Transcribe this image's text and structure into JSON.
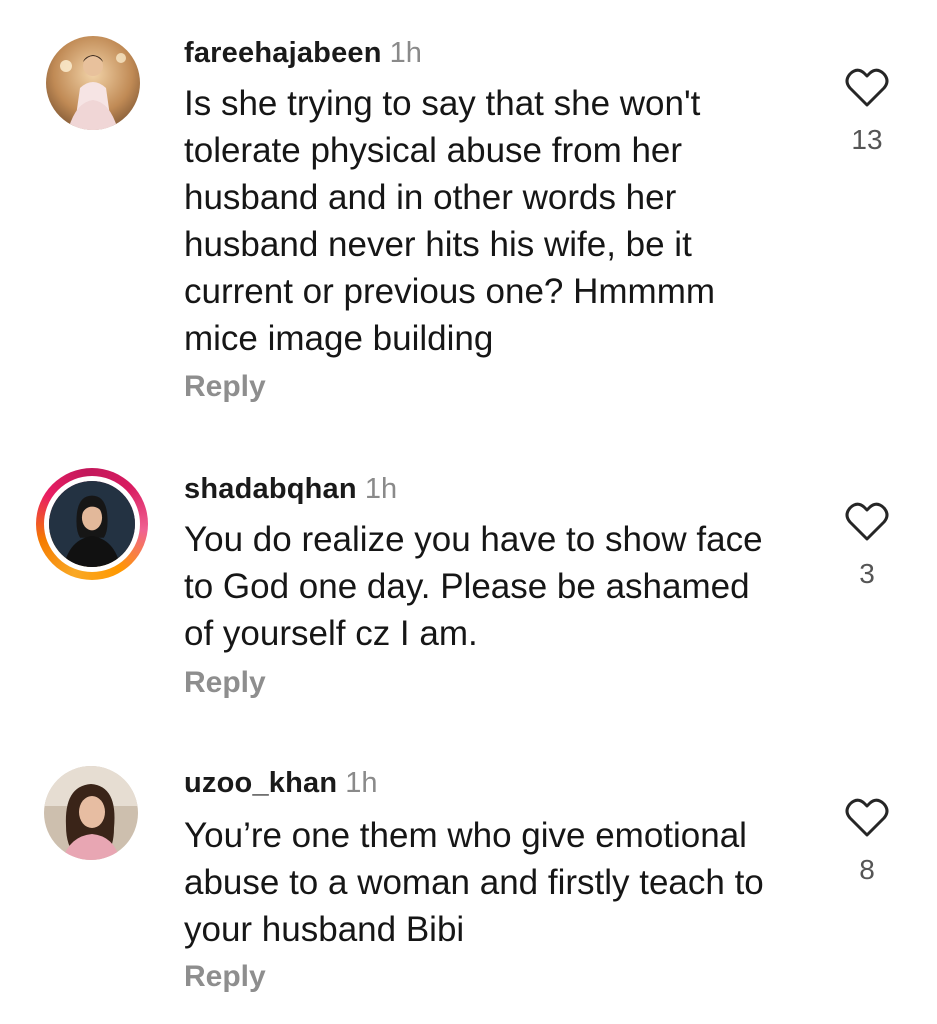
{
  "comments": [
    {
      "username": "fareehajabeen",
      "time": "1h",
      "text": "Is she trying to say that she won't tolerate physical abuse from her husband and in other words her husband never hits his wife, be it current or previous one? Hmmmm mice image building",
      "reply_label": "Reply",
      "likes": "13",
      "has_story": false
    },
    {
      "username": "shadabqhan",
      "time": "1h",
      "text": "You do realize you have to show face to God one day. Please be ashamed of yourself cz I am.",
      "reply_label": "Reply",
      "likes": "3",
      "has_story": true
    },
    {
      "username": "uzoo_khan",
      "time": "1h",
      "text": "You’re one them who give emotional abuse to a woman and firstly teach to your husband Bibi",
      "reply_label": "Reply",
      "likes": "8",
      "has_story": false
    }
  ],
  "icons": {
    "like": "heart-outline-icon"
  },
  "colors": {
    "username": "#1a1a1a",
    "timestamp": "#8a8a8a",
    "reply": "#8e8e8e",
    "story_ring_start": "#f9a825",
    "story_ring_end": "#e91e63"
  }
}
